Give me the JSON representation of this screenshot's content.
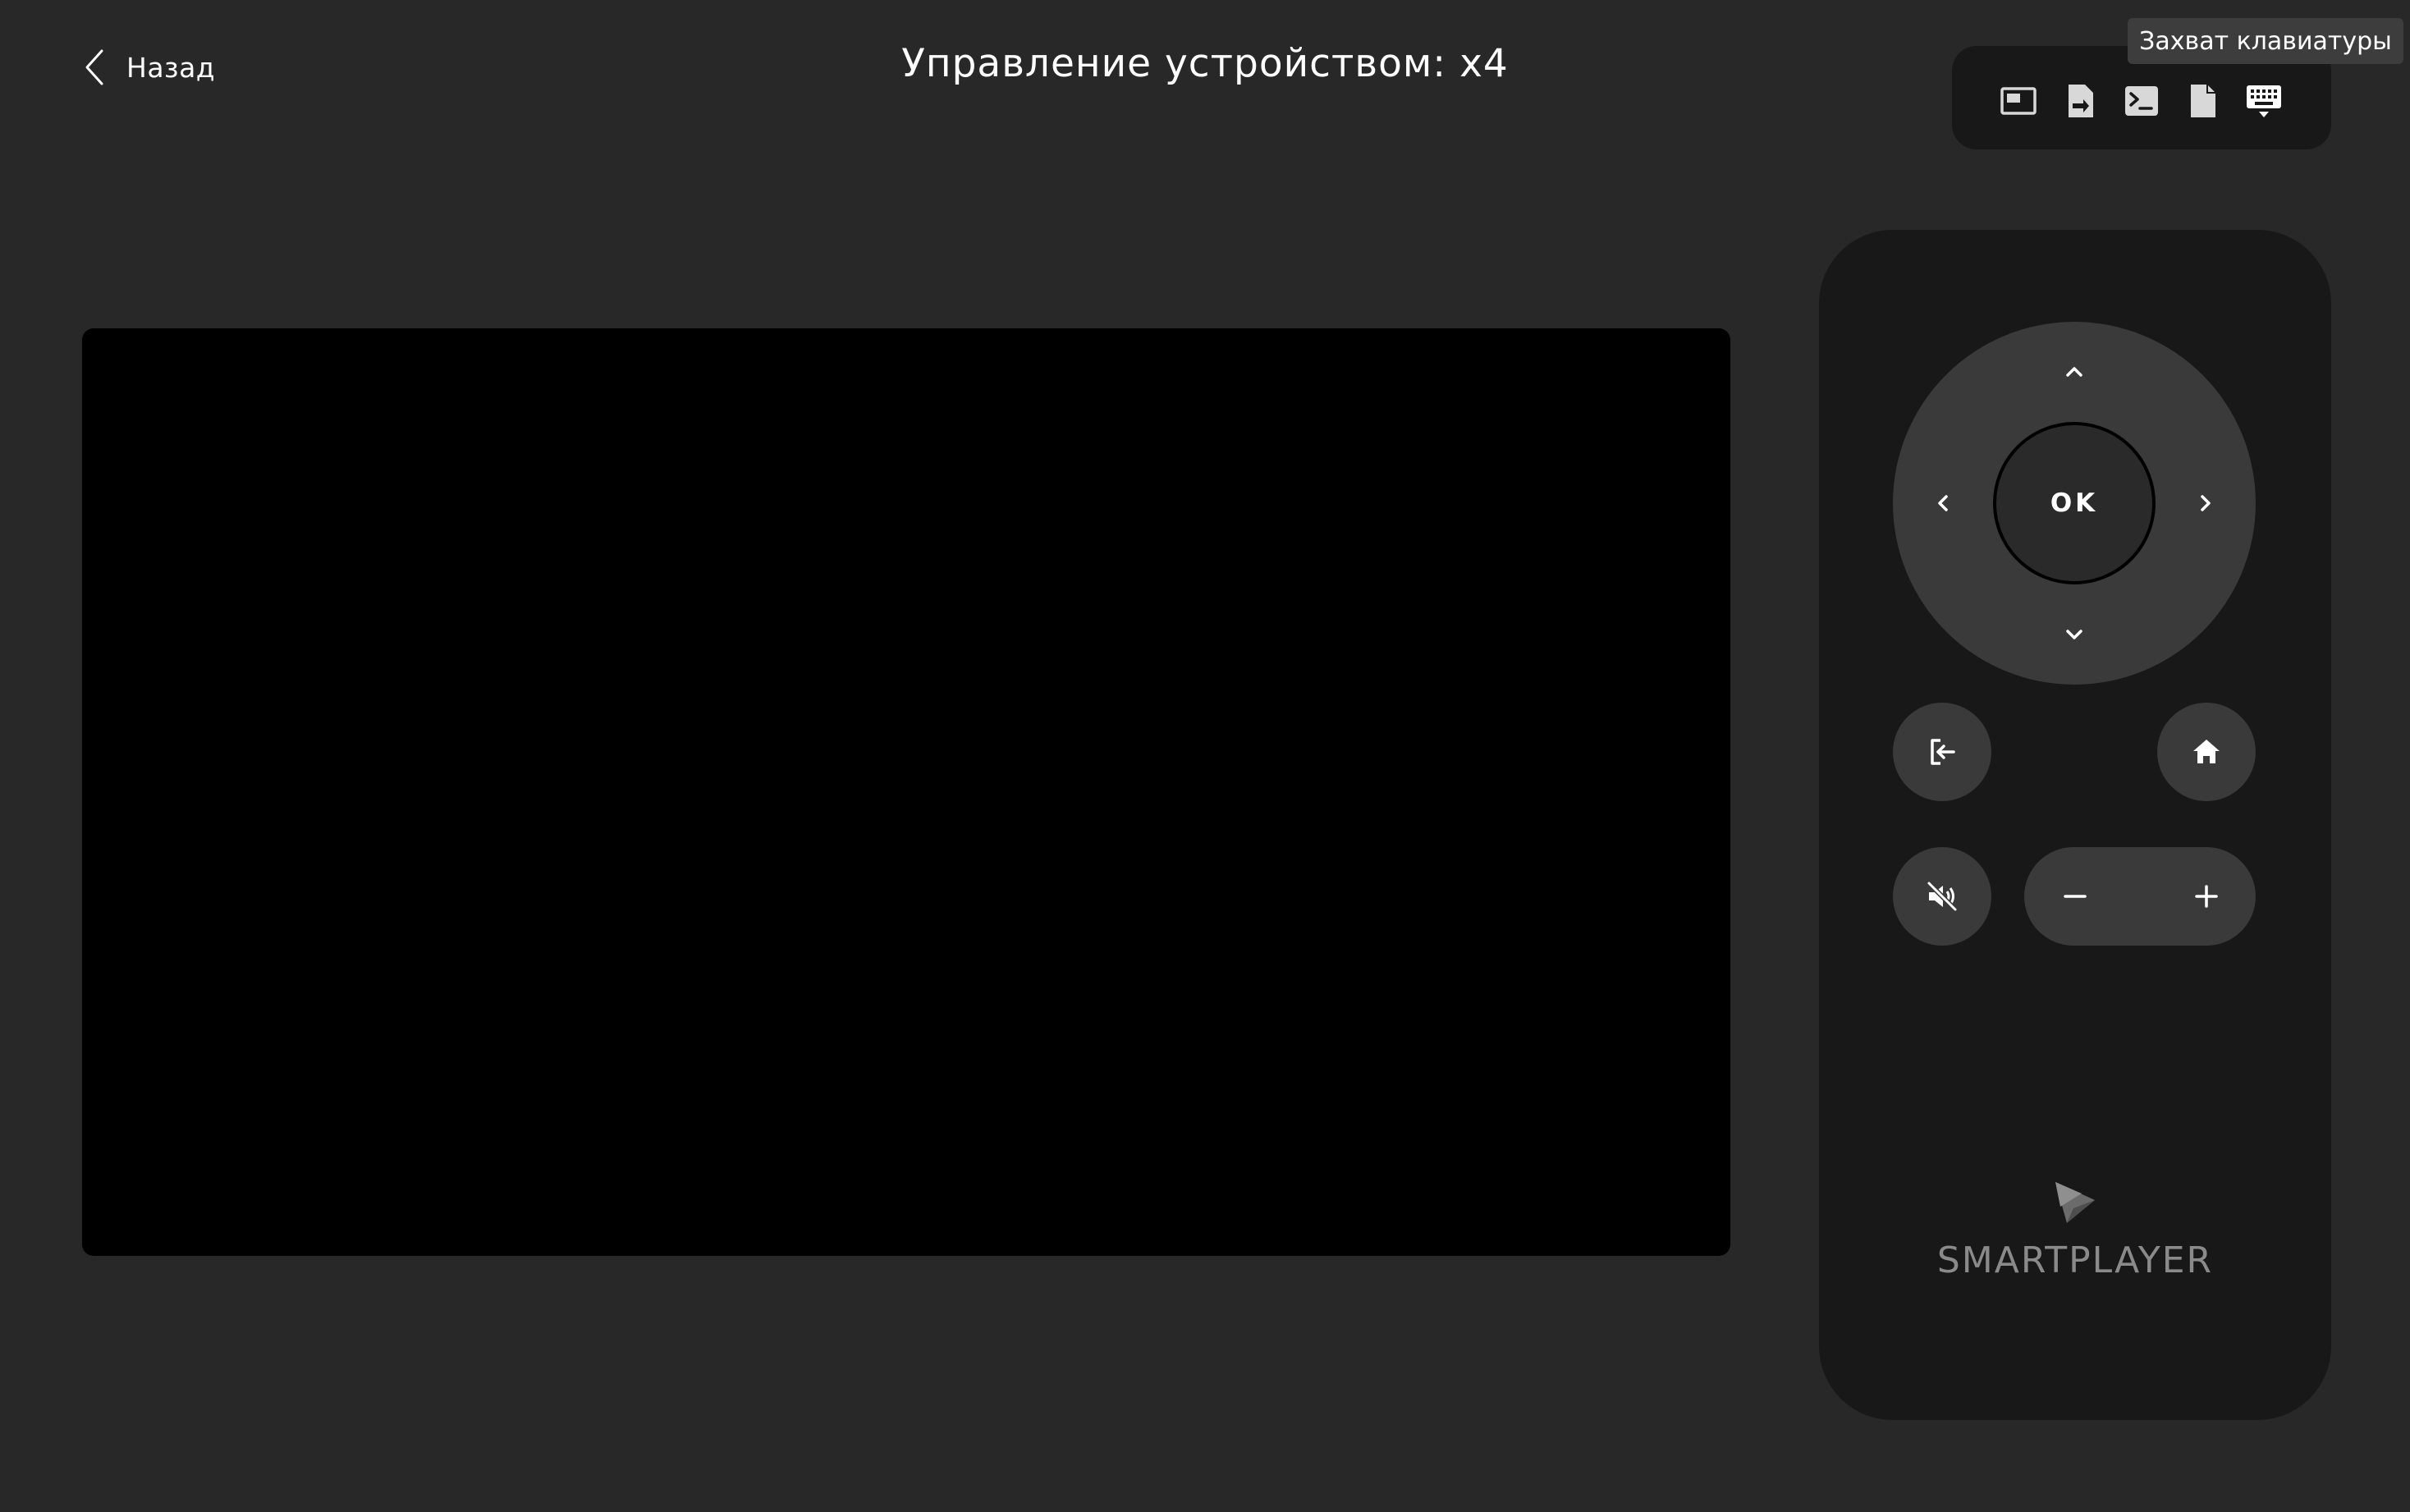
{
  "header": {
    "back_label": "Назад",
    "title": "Управление устройством: x4"
  },
  "toolbar": {
    "buttons": [
      {
        "name": "screen-icon"
      },
      {
        "name": "file-transfer-icon"
      },
      {
        "name": "terminal-icon"
      },
      {
        "name": "document-icon"
      },
      {
        "name": "keyboard-icon"
      }
    ],
    "tooltip": "Захват клавиатуры"
  },
  "remote": {
    "ok_label": "OK",
    "brand": "SMARTPLAYER"
  },
  "colors": {
    "background": "#282828",
    "panel": "#181818",
    "button": "#3a3a3a",
    "screen": "#000000"
  }
}
